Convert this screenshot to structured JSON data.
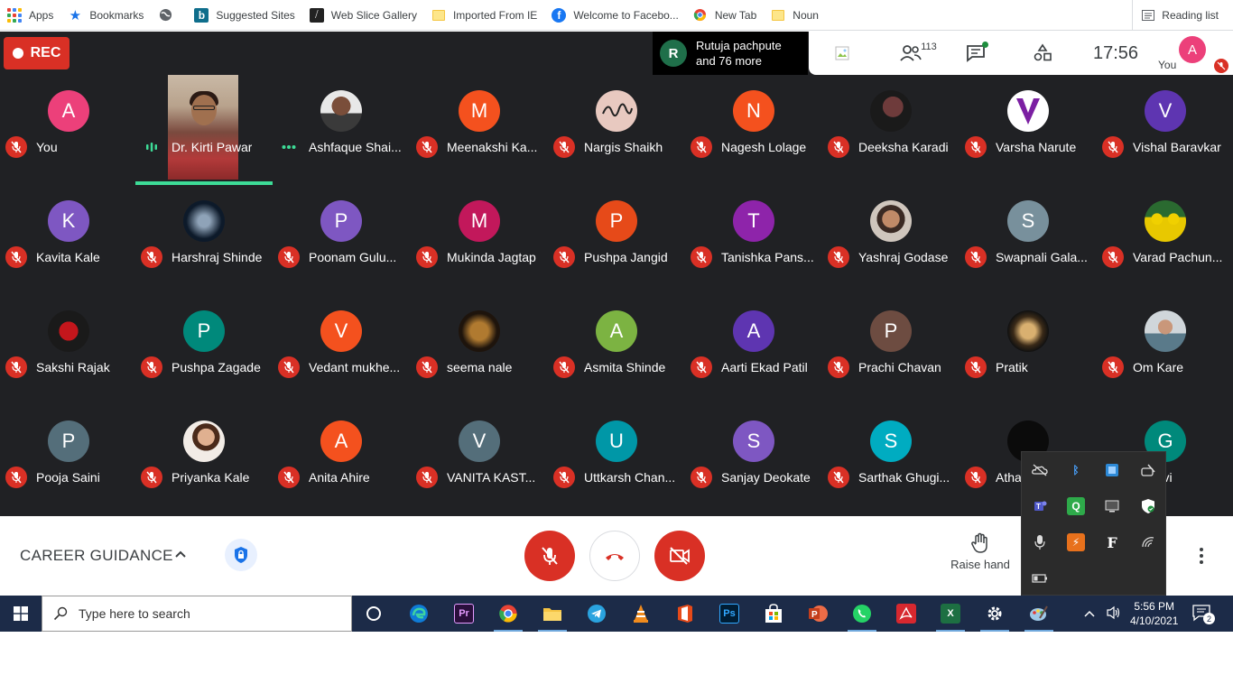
{
  "bookmarks": {
    "items": [
      {
        "label": "Apps",
        "icon": "apps-grid-icon"
      },
      {
        "label": "Bookmarks",
        "icon": "star-icon"
      },
      {
        "label": "",
        "icon": "globe-icon"
      },
      {
        "label": "Suggested Sites",
        "icon": "bing-icon"
      },
      {
        "label": "Web Slice Gallery",
        "icon": "web-slice-icon"
      },
      {
        "label": "Imported From IE",
        "icon": "folder-icon"
      },
      {
        "label": "Welcome to Facebo...",
        "icon": "facebook-icon"
      },
      {
        "label": "New Tab",
        "icon": "chrome-icon"
      },
      {
        "label": "Noun",
        "icon": "folder-icon"
      }
    ],
    "reading_list": "Reading list"
  },
  "meet": {
    "rec_label": "REC",
    "presenter": {
      "initial": "R",
      "line1": "Rutuja pachpute",
      "line2": "and 76 more"
    },
    "participants_count": "113",
    "clock": "17:56",
    "you_initial": "A",
    "you_label": "You",
    "participants": [
      {
        "name": "You",
        "initial": "A",
        "color": "#ec407a"
      },
      {
        "name": "Dr. Kirti Pawar",
        "video": true,
        "speaking": true
      },
      {
        "name": "Ashfaque Shai...",
        "photo": "man-portrait",
        "more": true
      },
      {
        "name": "Meenakshi Ka...",
        "initial": "M",
        "color": "#f4511e"
      },
      {
        "name": "Nargis Shaikh",
        "photo": "handwriting"
      },
      {
        "name": "Nagesh Lolage",
        "initial": "N",
        "color": "#f4511e"
      },
      {
        "name": "Deeksha Karadi",
        "photo": "woman-dark"
      },
      {
        "name": "Varsha Narute",
        "photo": "v-logo"
      },
      {
        "name": "Vishal Baravkar",
        "initial": "V",
        "color": "#5e35b1"
      },
      {
        "name": "Kavita Kale",
        "initial": "K",
        "color": "#7e57c2"
      },
      {
        "name": "Harshraj Shinde",
        "photo": "night-art"
      },
      {
        "name": "Poonam Gulu...",
        "initial": "P",
        "color": "#7e57c2"
      },
      {
        "name": "Mukinda Jagtap",
        "initial": "M",
        "color": "#c2185b"
      },
      {
        "name": "Pushpa Jangid",
        "initial": "P",
        "color": "#e64a19"
      },
      {
        "name": "Tanishka Pans...",
        "initial": "T",
        "color": "#8e24aa"
      },
      {
        "name": "Yashraj Godase",
        "photo": "boy-portrait"
      },
      {
        "name": "Swapnali Gala...",
        "initial": "S",
        "color": "#78909c"
      },
      {
        "name": "Varad Pachun...",
        "photo": "team-yellow"
      },
      {
        "name": "Sakshi Rajak",
        "photo": "red-rose"
      },
      {
        "name": "Pushpa Zagade",
        "initial": "P",
        "color": "#00897b"
      },
      {
        "name": "Vedant mukhe...",
        "initial": "V",
        "color": "#f4511e"
      },
      {
        "name": "seema nale",
        "photo": "lion"
      },
      {
        "name": "Asmita Shinde",
        "initial": "A",
        "color": "#7cb342"
      },
      {
        "name": "Aarti Ekad Patil",
        "initial": "A",
        "color": "#5e35b1"
      },
      {
        "name": "Prachi Chavan",
        "initial": "P",
        "color": "#6d4c41"
      },
      {
        "name": "Pratik",
        "photo": "skull-art"
      },
      {
        "name": "Om Kare",
        "photo": "man-casual"
      },
      {
        "name": "Pooja Saini",
        "initial": "P",
        "color": "#546e7a"
      },
      {
        "name": "Priyanka Kale",
        "photo": "girl-portrait"
      },
      {
        "name": "Anita Ahire",
        "initial": "A",
        "color": "#f4511e"
      },
      {
        "name": "VANITA KAST...",
        "initial": "V",
        "color": "#546e7a"
      },
      {
        "name": "Uttkarsh Chan...",
        "initial": "U",
        "color": "#0097a7"
      },
      {
        "name": "Sanjay Deokate",
        "initial": "S",
        "color": "#7e57c2"
      },
      {
        "name": "Sarthak Ghugi...",
        "initial": "S",
        "color": "#00acc1"
      },
      {
        "name": "Atha...",
        "photo": "dark-avatar"
      },
      {
        "name": "Gosavi",
        "initial": "G",
        "color": "#00897b"
      }
    ]
  },
  "bottombar": {
    "meeting_title": "CAREER GUIDANCE",
    "raise_hand": "Raise hand"
  },
  "taskbar": {
    "search_placeholder": "Type here to search",
    "time": "5:56 PM",
    "date": "4/10/2021",
    "notif_count": "2"
  }
}
